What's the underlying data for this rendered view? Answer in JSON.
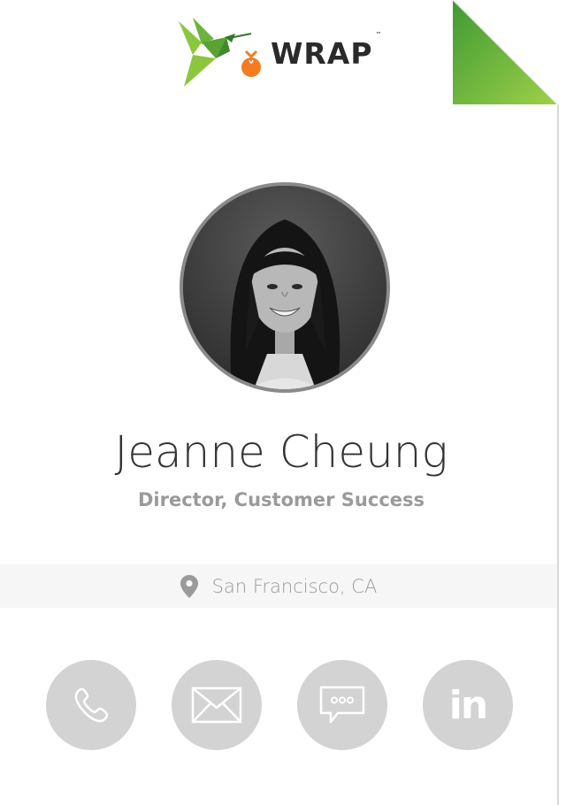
{
  "brand": {
    "name": "WRAP",
    "trademark": "™",
    "colors": {
      "green": "#8cc63f",
      "green_dark": "#4a9a2a",
      "orange": "#f47b20",
      "text": "#2a2a2a"
    }
  },
  "profile": {
    "name": "Jeanne Cheung",
    "title": "Director, Customer Success",
    "location": "San Francisco, CA",
    "avatar": "portrait-photo"
  },
  "actions": [
    {
      "icon": "phone-icon",
      "label": "Call"
    },
    {
      "icon": "email-icon",
      "label": "Email"
    },
    {
      "icon": "message-icon",
      "label": "Message"
    },
    {
      "icon": "linkedin-icon",
      "label": "in"
    }
  ],
  "colors": {
    "action_bg": "#d3d3d3",
    "muted_text": "#9a9a9a",
    "name_text": "#333333",
    "location_bar_bg": "#f6f6f6"
  }
}
